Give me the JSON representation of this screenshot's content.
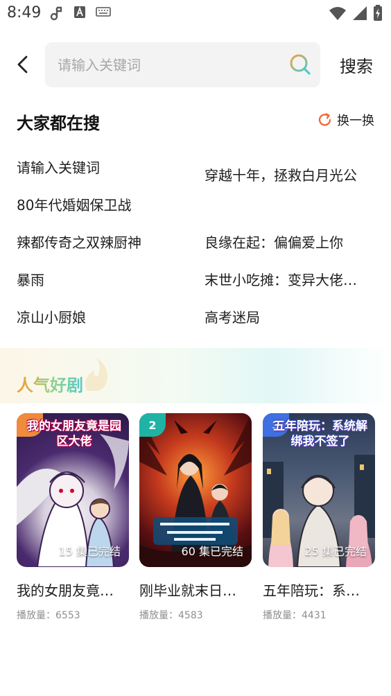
{
  "status_bar": {
    "time": "8:49",
    "left_icons": [
      "music-note-icon",
      "app-a-icon",
      "keyboard-icon"
    ],
    "right_icons": [
      "wifi-icon",
      "cellular-icon",
      "battery-charging-icon"
    ]
  },
  "search": {
    "placeholder": "请输入关键词",
    "button_label": "搜索"
  },
  "hot_search": {
    "title": "大家都在搜",
    "refresh_label": "换一换",
    "items": [
      "请输入关键词",
      "穿越十年，拯救白月光公",
      "80年代婚姻保卫战",
      "辣都传奇之双辣厨神",
      "良缘在起：偏偏爱上你",
      "暴雨",
      "末世小吃摊：变异大佬…",
      "凉山小厨娘",
      "高考迷局"
    ]
  },
  "popular": {
    "title": "人气好剧",
    "cards": [
      {
        "rank": "1",
        "poster_text": "我的女朋友竟是园区大佬",
        "episodes": "15 集已完结",
        "name": "我的女朋友竟…",
        "plays": "播放量：6553"
      },
      {
        "rank": "2",
        "poster_text": "",
        "episodes": "60 集已完结",
        "name": "刚毕业就末日…",
        "plays": "播放量：4583"
      },
      {
        "rank": "3",
        "poster_text": "五年陪玩：系统解绑我不签了",
        "episodes": "25 集已完结",
        "name": "五年陪玩：系…",
        "plays": "播放量：4431"
      }
    ]
  },
  "colors": {
    "rank_1": "#f08a3c",
    "rank_2": "#1fb3a5",
    "rank_3": "#3f6fe0",
    "refresh_icon": "#f26b3a",
    "search_icon_a": "#f2a23a",
    "search_icon_b": "#4fc9c8"
  }
}
